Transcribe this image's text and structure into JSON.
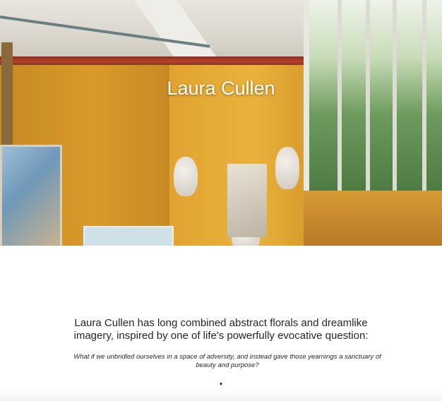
{
  "hero": {
    "title": "Laura Cullen",
    "image_alt": "artist studio with busts and paintings"
  },
  "intro": {
    "text": "Laura Cullen has long combined abstract florals and dreamlike imagery, inspired by one of life's powerfully evocative question:"
  },
  "quote": {
    "text": "What if we unbridled ourselves in a space of adversity, and instead gave those yearnings a sanctuary of beauty and purpose?"
  },
  "ornament": {
    "glyph": "♦"
  },
  "colors": {
    "wall_ochre": "#d99a2a",
    "text_dark": "#262626",
    "title_white": "#ffffff"
  }
}
